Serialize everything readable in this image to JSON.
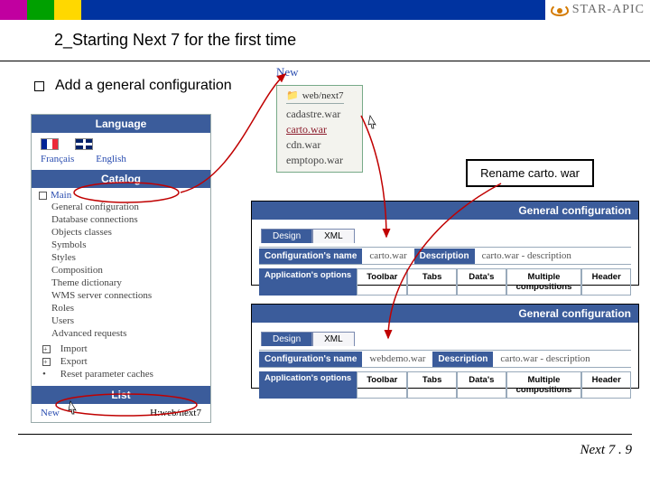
{
  "brand": "STAR-APIC",
  "title": "2_Starting Next 7 for the first time",
  "bullet": "Add a general configuration",
  "sidebar": {
    "lang_header": "Language",
    "lang_fr": "Français",
    "lang_en": "English",
    "catalog_header": "Catalog",
    "main": "Main",
    "items": [
      "General configuration",
      "Database connections",
      "Objects classes",
      "Symbols",
      "Styles",
      "Composition",
      "Theme dictionary",
      "WMS server connections",
      "Roles",
      "Users",
      "Advanced requests"
    ],
    "extras": [
      "Import",
      "Export",
      "Reset parameter caches"
    ],
    "list_header": "List",
    "list_new": "New",
    "list_path": "H:web/next7"
  },
  "newmenu": {
    "label": "New",
    "path_icon": "folder-icon",
    "path": "web/next7",
    "items": [
      "cadastre.war",
      "carto.war",
      "cdn.war",
      "emptopo.war"
    ],
    "selected_index": 1
  },
  "rename": "Rename carto. war",
  "cfg": {
    "header": "General configuration",
    "tabs": [
      "Design",
      "XML"
    ],
    "name_label": "Configuration's name",
    "desc_label": "Description",
    "opts_label": "Application's options",
    "opt_cols": [
      "Toolbar",
      "Tabs",
      "Data's",
      "Multiple compositions",
      "Header"
    ],
    "row1": {
      "name": "carto.war",
      "desc": "carto.war - description"
    },
    "row2": {
      "name": "webdemo.war",
      "desc": "carto.war - description"
    }
  },
  "footer": "Next 7 . 9"
}
